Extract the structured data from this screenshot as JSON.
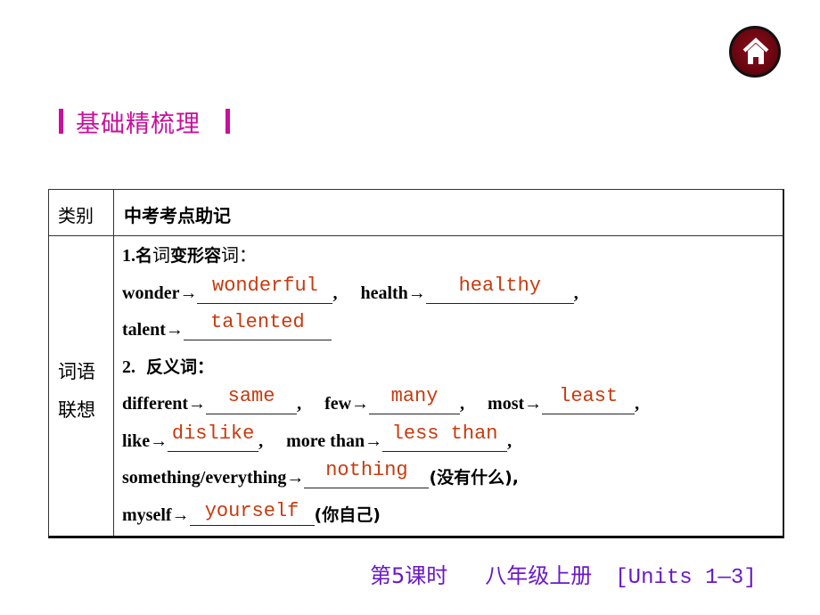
{
  "nav": {
    "home_icon": "home-icon",
    "home_button_color": "#6a0610"
  },
  "section": {
    "title": "基础精梳理",
    "accent_color": "#c8109a"
  },
  "table": {
    "headers": {
      "category": "类别",
      "content": "中考考点助记"
    },
    "category_label_line1": "词语",
    "category_label_line2": "联想",
    "part1": {
      "title": "1.名词变形容词：",
      "items": [
        {
          "word": "wonder→",
          "answer": "wonderful",
          "suffix": ","
        },
        {
          "word": "health→",
          "answer": "healthy",
          "suffix": ","
        },
        {
          "word": "talent→",
          "answer": "talented",
          "suffix": ""
        }
      ]
    },
    "part2": {
      "title_num": "2.",
      "title_cn": "反义词：",
      "items": [
        {
          "word": "different→",
          "answer": "same",
          "suffix": ","
        },
        {
          "word": "few→",
          "answer": "many",
          "suffix": ","
        },
        {
          "word": "most→",
          "answer": "least",
          "suffix": ","
        },
        {
          "word": "like→",
          "answer": "dislike",
          "suffix": ","
        },
        {
          "word": "more than→",
          "answer": "less than",
          "suffix": ","
        },
        {
          "word": "something/everything→",
          "answer": "nothing",
          "note": "(没有什么),"
        },
        {
          "word": "myself→",
          "answer": "yourself",
          "note": "(你自己)"
        }
      ]
    },
    "answer_color": "#c83a0e"
  },
  "footer": {
    "lesson": "第5课时",
    "book": "八年级上册",
    "units": "[Units 1—3]",
    "color": "#6a18c8"
  }
}
